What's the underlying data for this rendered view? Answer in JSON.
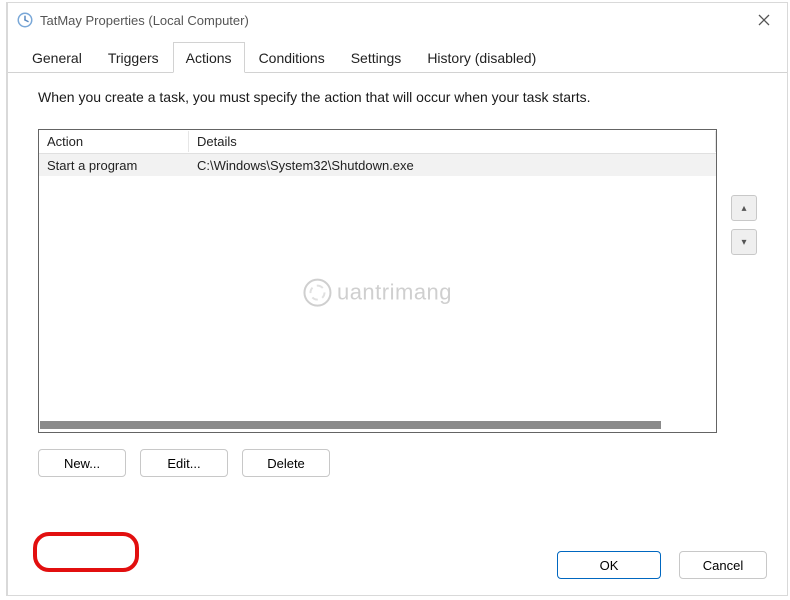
{
  "window": {
    "title": "TatMay Properties (Local Computer)"
  },
  "tabs": {
    "general": "General",
    "triggers": "Triggers",
    "actions": "Actions",
    "conditions": "Conditions",
    "settings": "Settings",
    "history": "History (disabled)"
  },
  "active_tab": "actions",
  "instruction": "When you create a task, you must specify the action that will occur when your task starts.",
  "columns": {
    "action": "Action",
    "details": "Details"
  },
  "rows": [
    {
      "action": "Start a program",
      "details": "C:\\Windows\\System32\\Shutdown.exe"
    }
  ],
  "buttons": {
    "new": "New...",
    "edit": "Edit...",
    "delete": "Delete",
    "ok": "OK",
    "cancel": "Cancel"
  },
  "watermark_text": "uantrimang"
}
